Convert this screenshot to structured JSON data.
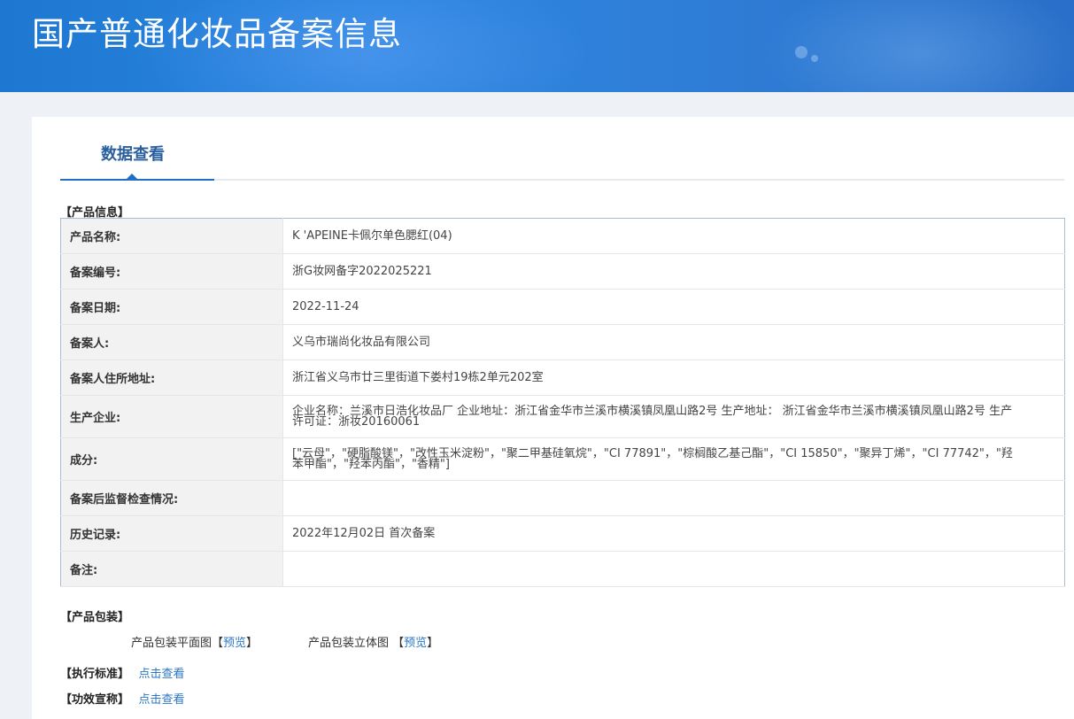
{
  "header": {
    "title": "国产普通化妆品备案信息"
  },
  "tabs": [
    {
      "label": "数据查看"
    }
  ],
  "product_info": {
    "section_title": "【产品信息】",
    "rows": [
      {
        "label": "产品名称:",
        "value": "K 'APEINE卡佩尔单色腮红(04)"
      },
      {
        "label": "备案编号:",
        "value": "浙G妆网备字2022025221"
      },
      {
        "label": "备案日期:",
        "value": "2022-11-24"
      },
      {
        "label": "备案人:",
        "value": "义乌市瑞尚化妆品有限公司"
      },
      {
        "label": "备案人住所地址:",
        "value": "浙江省义乌市廿三里街道下娄村19栋2单元202室"
      },
      {
        "label": "生产企业:",
        "value": "企业名称：兰溪市日浩化妆品厂 企业地址：浙江省金华市兰溪市横溪镇凤凰山路2号 生产地址： 浙江省金华市兰溪市横溪镇凤凰山路2号 生产许可证：浙妆20160061"
      },
      {
        "label": "成分:",
        "value": "[\"云母\"，\"硬脂酸镁\"，\"改性玉米淀粉\"，\"聚二甲基硅氧烷\"，\"CI 77891\"，\"棕榈酸乙基己酯\"，\"CI 15850\"，\"聚异丁烯\"，\"CI 77742\"，\"羟苯甲酯\"，\"羟苯丙酯\"，\"香精\"]"
      },
      {
        "label": "备案后监督检查情况:",
        "value": ""
      },
      {
        "label": "历史记录:",
        "value": "2022年12月02日 首次备案"
      },
      {
        "label": "备注:",
        "value": ""
      }
    ]
  },
  "packaging": {
    "section_title": "【产品包装】",
    "flat_label": "产品包装平面图",
    "flat_link": "预览",
    "stereo_label": "产品包装立体图",
    "stereo_link": "预览"
  },
  "standard": {
    "section_title": "【执行标准】",
    "link": "点击查看"
  },
  "efficacy": {
    "section_title": "【功效宣称】",
    "link": "点击查看"
  }
}
